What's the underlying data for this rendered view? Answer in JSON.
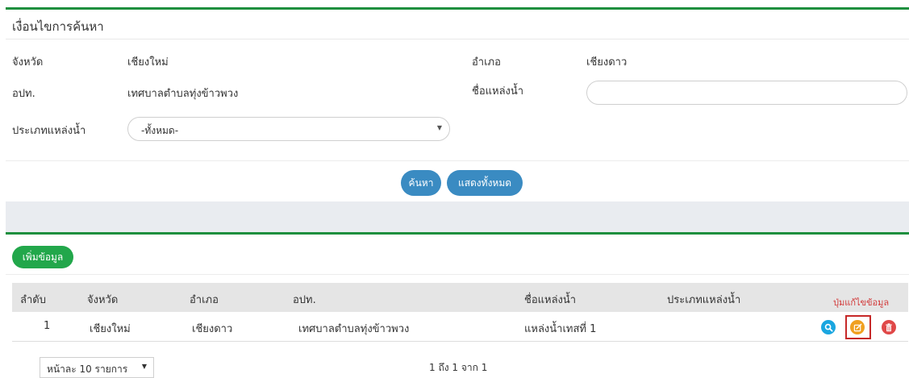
{
  "search": {
    "title": "เงื่อนไขการค้นหา",
    "province_label": "จังหวัด",
    "province_value": "เชียงใหม่",
    "district_label": "อำเภอ",
    "district_value": "เชียงดาว",
    "lao_label": "อปท.",
    "lao_value": "เทศบาลตำบลทุ่งข้าวพวง",
    "source_name_label": "ชื่อแหล่งน้ำ",
    "source_name_value": "",
    "source_type_label": "ประเภทแหล่งน้ำ",
    "source_type_selected": "-ทั้งหมด-",
    "search_button": "ค้นหา",
    "show_all_button": "แสดงทั้งหมด"
  },
  "table": {
    "add_button": "เพิ่มข้อมูล",
    "headers": [
      "ลำดับ",
      "จังหวัด",
      "อำเภอ",
      "อปท.",
      "ชื่อแหล่งน้ำ",
      "ประเภทแหล่งน้ำ"
    ],
    "edit_column_note": "ปุ่มแก้ไขข้อมูล",
    "rows": [
      [
        "1",
        "เชียงใหม่",
        "เชียงดาว",
        "เทศบาลตำบลทุ่งข้าวพวง",
        "แหล่งน้ำเทสที่ 1",
        ""
      ]
    ]
  },
  "footer": {
    "per_page": "หน้าละ 10 รายการ",
    "paging_info": "1 ถึง 1 จาก 1"
  },
  "colors": {
    "view_icon": "#1aa6e0",
    "edit_icon": "#f0a020",
    "delete_icon": "#e04848",
    "accent_green": "#1e8f3e",
    "button_blue": "#3a8bc2"
  }
}
